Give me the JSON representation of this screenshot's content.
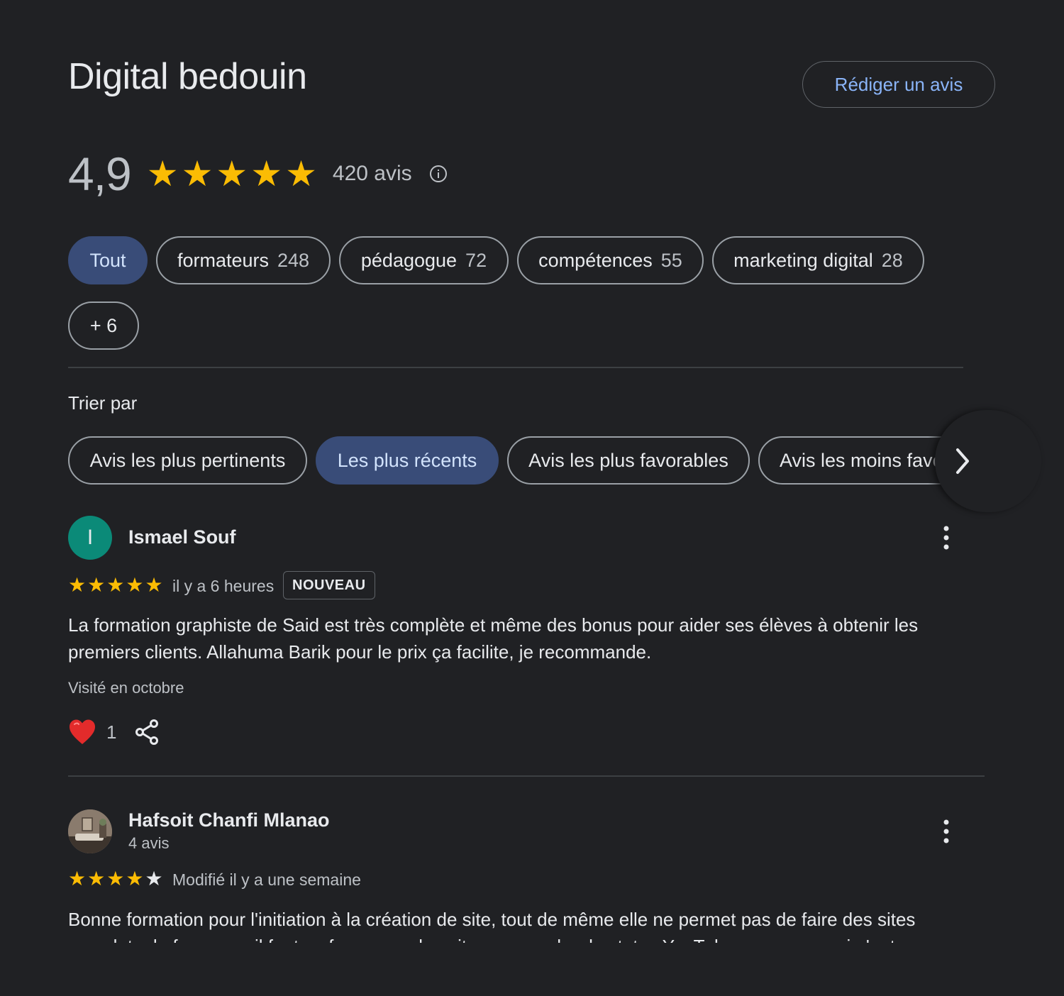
{
  "header": {
    "title": "Digital bedouin",
    "write_review_label": "Rédiger un avis"
  },
  "summary": {
    "rating": "4,9",
    "stars_filled": 5,
    "review_count": "420 avis",
    "info_icon": "info-icon"
  },
  "topics": [
    {
      "label": "Tout",
      "count": "",
      "active": true
    },
    {
      "label": "formateurs",
      "count": "248",
      "active": false
    },
    {
      "label": "pédagogue",
      "count": "72",
      "active": false
    },
    {
      "label": "compétences",
      "count": "55",
      "active": false
    },
    {
      "label": "marketing digital",
      "count": "28",
      "active": false
    },
    {
      "label": "+ 6",
      "count": "",
      "active": false
    }
  ],
  "sort": {
    "label": "Trier par",
    "options": [
      {
        "label": "Avis les plus pertinents",
        "active": false
      },
      {
        "label": "Les plus récents",
        "active": true
      },
      {
        "label": "Avis les plus favorables",
        "active": false
      },
      {
        "label": "Avis les moins favorables",
        "active": false
      }
    ],
    "next_icon": "chevron-right-icon"
  },
  "reviews": [
    {
      "avatar_letter": "I",
      "avatar_color": "#0b8a78",
      "name": "Ismael Souf",
      "stars": 5,
      "time": "il y a 6 heures",
      "badge": "NOUVEAU",
      "text": "La formation graphiste de Said est très complète et même des bonus pour aider ses élèves à obtenir les premiers clients. Allahuma Barik pour le prix ça facilite, je recommande.",
      "visited": "Visité en octobre",
      "likes": "1",
      "like_icon": "heart-icon",
      "share_icon": "share-icon"
    },
    {
      "avatar": "profile-photo",
      "name": "Hafsoit Chanfi Mlanao",
      "meta": "4 avis",
      "stars": 4,
      "time": "Modifié il y a une semaine",
      "text": "Bonne formation pour l'initiation à la création de site, tout de même elle ne permet pas de faire des sites complets de façon pro il faut se former par la suite ou regarder des tutos YouTube pour ceux qui n'ont pas"
    }
  ],
  "colors": {
    "background": "#202124",
    "accent_link": "#8ab4f8",
    "active_chip": "#394c78",
    "star": "#fbbc04"
  }
}
